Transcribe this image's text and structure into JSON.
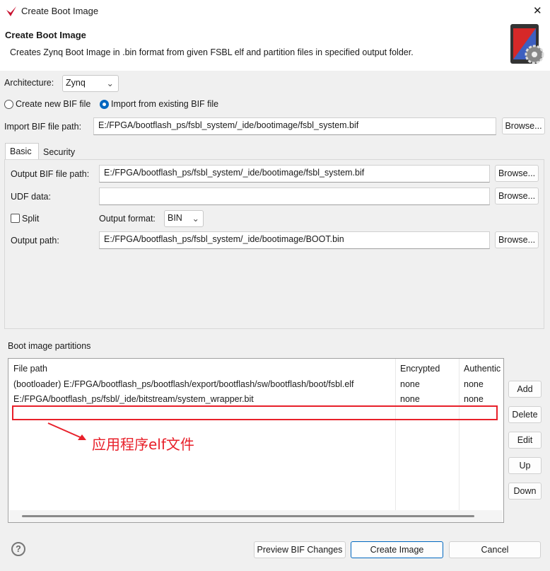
{
  "window": {
    "title": "Create Boot Image",
    "close": "✕"
  },
  "header": {
    "title": "Create Boot Image",
    "description": "Creates Zynq Boot Image in .bin format from given FSBL elf and partition files in specified output folder."
  },
  "architecture": {
    "label": "Architecture:",
    "value": "Zynq"
  },
  "bif_mode": {
    "create_new": "Create new BIF file",
    "import_existing": "Import from existing BIF file",
    "selected": "import_existing"
  },
  "import_bif": {
    "label": "Import BIF file path:",
    "value": "E:/FPGA/bootflash_ps/fsbl_system/_ide/bootimage/fsbl_system.bif",
    "browse": "Browse..."
  },
  "tabs": [
    {
      "label": "Basic",
      "active": true
    },
    {
      "label": "Security",
      "active": false
    }
  ],
  "basic": {
    "output_bif": {
      "label": "Output BIF file path:",
      "value": "E:/FPGA/bootflash_ps/fsbl_system/_ide/bootimage/fsbl_system.bif",
      "browse": "Browse..."
    },
    "udf": {
      "label": "UDF data:",
      "value": "",
      "browse": "Browse..."
    },
    "split": {
      "label": "Split",
      "checked": false
    },
    "output_format": {
      "label": "Output format:",
      "value": "BIN"
    },
    "output_path": {
      "label": "Output path:",
      "value": "E:/FPGA/bootflash_ps/fsbl_system/_ide/bootimage/BOOT.bin",
      "browse": "Browse..."
    }
  },
  "partitions": {
    "label": "Boot image partitions",
    "columns": [
      "File path",
      "Encrypted",
      "Authentic"
    ],
    "rows": [
      [
        "(bootloader) E:/FPGA/bootflash_ps/bootflash/export/bootflash/sw/bootflash/boot/fsbl.elf",
        "none",
        "none"
      ],
      [
        "E:/FPGA/bootflash_ps/fsbl/_ide/bitstream/system_wrapper.bit",
        "none",
        "none"
      ]
    ],
    "buttons": [
      "Add",
      "Delete",
      "Edit",
      "Up",
      "Down"
    ]
  },
  "annotation": {
    "text": "应用程序elf文件",
    "color": "#e8202a"
  },
  "footer": {
    "preview": "Preview BIF Changes",
    "create": "Create Image",
    "cancel": "Cancel",
    "help": "?"
  },
  "colors": {
    "accent": "#0067c0",
    "annotation": "#e8202a"
  }
}
